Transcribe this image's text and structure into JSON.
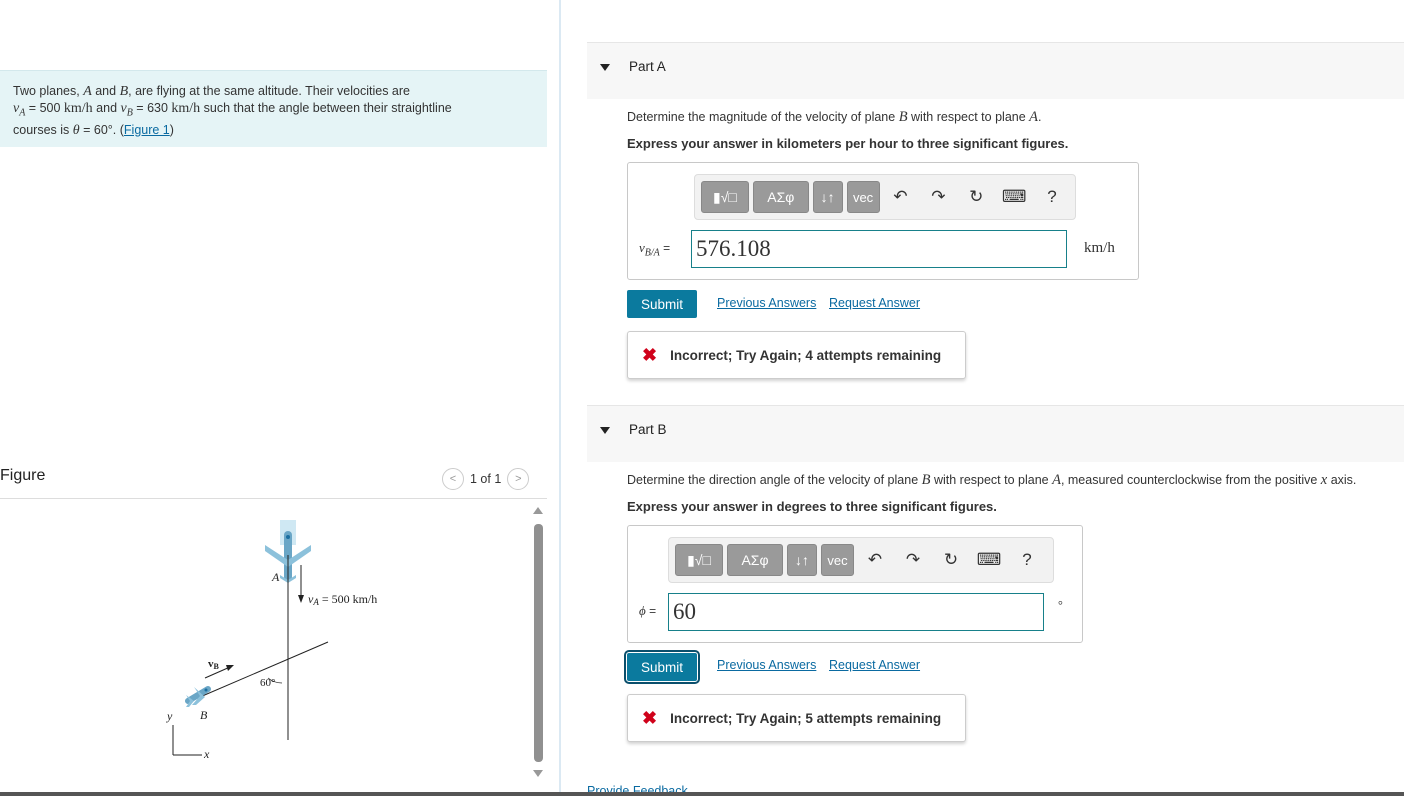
{
  "problem": {
    "t1": "Two planes, ",
    "A": "A",
    "t2": " and ",
    "B": "B",
    "t3": ", are flying at the same altitude. Their velocities are",
    "vA": "v",
    "vAsub": "A",
    "t4": " = 500 ",
    "u1": "km/h",
    "t5": " and ",
    "vB": "v",
    "vBsub": "B",
    "t6": " = 630 ",
    "u2": "km/h",
    "t7": " such that the angle between their straightline",
    "t8": "courses is ",
    "theta": "θ",
    "t9": " = 60°. (",
    "link": "Figure 1",
    "t10": ")"
  },
  "figure": {
    "title": "Figure",
    "pager": "1 of 1",
    "prev": "<",
    "next": ">",
    "label_A": "A",
    "label_B": "B",
    "label_vB": "v",
    "label_vBsub": "B",
    "label_vA": "v",
    "label_vAsub": "A",
    "label_vA_val": " = 500 km/h",
    "angle": "60°",
    "axis_y": "y",
    "axis_x": "x"
  },
  "toolbar": {
    "templates": "▮√□",
    "greek": "ΑΣφ",
    "arrows": "↓↑",
    "vec": "vec",
    "undo": "↶",
    "redo": "↷",
    "reset": "↻",
    "keyboard": "⌨",
    "help": "?"
  },
  "partA": {
    "label": "Part A",
    "q1": "Determine the magnitude of the velocity of plane ",
    "qB": "B",
    "q2": " with respect to plane ",
    "qA": "A",
    "q3": ".",
    "instruction": "Express your answer in kilometers per hour to three significant figures.",
    "var": "v",
    "varsub": "B/A",
    "eq": " =",
    "value": "576.108",
    "unit": "km/h",
    "submit": "Submit",
    "prev": "Previous Answers",
    "req": "Request Answer",
    "feedback": "Incorrect; Try Again; 4 attempts remaining"
  },
  "partB": {
    "label": "Part B",
    "q1": "Determine the direction angle of the velocity of plane ",
    "qB": "B",
    "q2": " with respect to plane ",
    "qA": "A",
    "q3": ", measured counterclockwise from the positive ",
    "qx": "x",
    "q4": " axis.",
    "instruction": "Express your answer in degrees to three significant figures.",
    "var": "ϕ",
    "eq": " =",
    "value": "60",
    "unit": "°",
    "submit": "Submit",
    "prev": "Previous Answers",
    "req": "Request Answer",
    "feedback": "Incorrect; Try Again; 5 attempts remaining"
  },
  "footer": {
    "provide_feedback": "Provide Feedback"
  },
  "colors": {
    "accent": "#0b7a9e",
    "problem_bg": "#e5f4f6",
    "error": "#d0021b",
    "field_border": "#17808a"
  }
}
